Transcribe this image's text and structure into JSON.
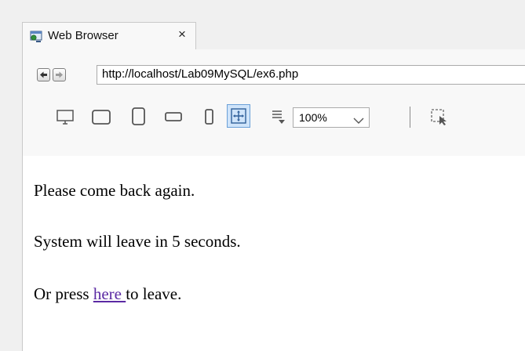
{
  "tab": {
    "title": "Web Browser",
    "close_symbol": "×"
  },
  "address_bar": {
    "url": "http://localhost/Lab09MySQL/ex6.php"
  },
  "toolbar": {
    "zoom": {
      "selected": "100%"
    },
    "devices": [
      "desktop-icon",
      "laptop-icon",
      "tablet-icon",
      "tablet-landscape-icon",
      "phone-icon",
      "fit-to-window-icon",
      "zoom-list-icon",
      "inspect-icon"
    ]
  },
  "page": {
    "line1": "Please come back again.",
    "line2": "System will leave in 5 seconds.",
    "line3_prefix": "Or press ",
    "line3_link": "here ",
    "line3_suffix": "to leave."
  },
  "colors": {
    "link": "#5b2aa3",
    "selected_tool": "#cfe4fa"
  }
}
